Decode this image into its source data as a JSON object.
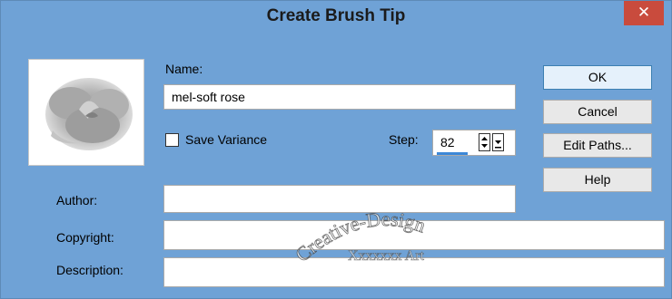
{
  "window": {
    "title": "Create Brush Tip",
    "close_glyph": "✕"
  },
  "form": {
    "name_label": "Name:",
    "name_value": "mel-soft rose",
    "save_variance_label": "Save Variance",
    "save_variance_checked": false,
    "step_label": "Step:",
    "step_value": "82",
    "author_label": "Author:",
    "author_value": "",
    "copyright_label": "Copyright:",
    "copyright_value": "",
    "description_label": "Description:",
    "description_value": ""
  },
  "buttons": {
    "ok": "OK",
    "cancel": "Cancel",
    "edit_paths": "Edit Paths...",
    "help": "Help"
  },
  "watermark": {
    "text": "Creative-Design",
    "subtext": "Xxxxxxx Art"
  },
  "icons": {
    "preview": "rose-brush-preview-icon",
    "spin_up": "arrow-up-icon",
    "spin_down": "arrow-down-icon",
    "close": "close-icon"
  },
  "colors": {
    "titlebar": "#6fa2d6",
    "close": "#c94b3d",
    "accent": "#3c7fb1"
  }
}
